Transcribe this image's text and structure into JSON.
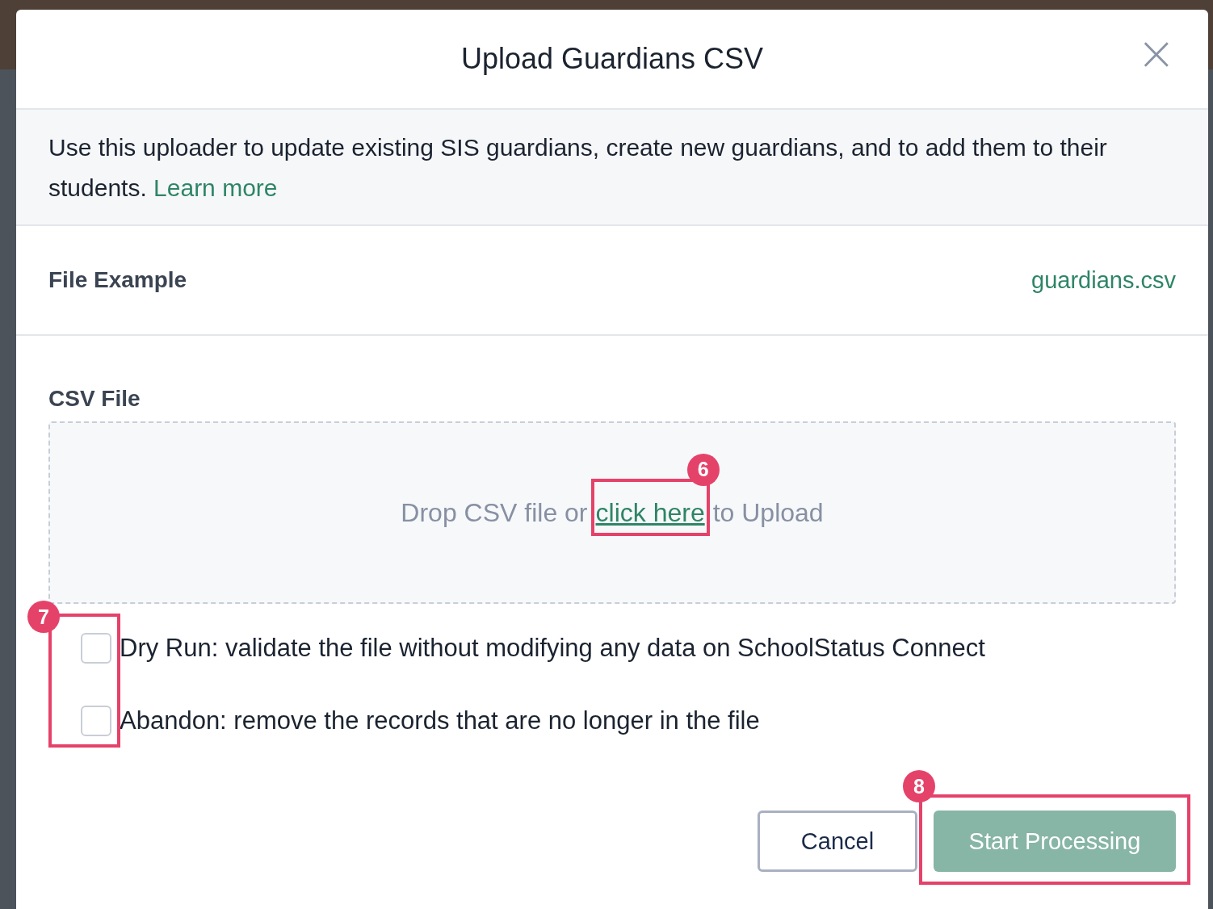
{
  "dialog": {
    "title": "Upload Guardians CSV",
    "close": "×"
  },
  "intro": {
    "text": "Use this uploader to update existing SIS guardians, create new guardians, and to add them to their students.",
    "link": "Learn more"
  },
  "file_example": {
    "label": "File Example",
    "link": "guardians.csv"
  },
  "csv_file": {
    "label": "CSV File",
    "drop_text_before": "Drop CSV file or",
    "link": "click here",
    "drop_text_after": "to Upload",
    "annotation": "6"
  },
  "options": {
    "annotation": "7",
    "items": [
      {
        "label": "Dry Run: validate the file without modifying any data on SchoolStatus Connect",
        "checked": false
      },
      {
        "label": "Abandon: remove the records that are no longer in the file",
        "checked": false
      }
    ]
  },
  "buttons": [
    {
      "kind": "secondary",
      "label": "Cancel"
    },
    {
      "kind": "primary",
      "label": "Start Processing",
      "disabled": true,
      "annotation": "8"
    }
  ]
}
